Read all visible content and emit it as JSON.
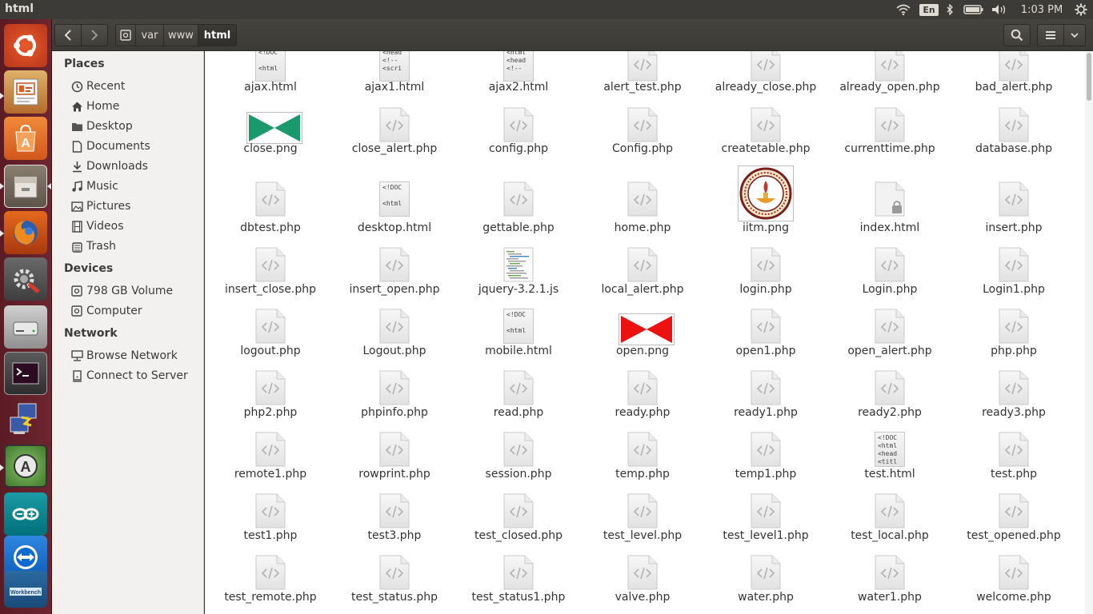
{
  "window": {
    "title": "html"
  },
  "top_panel": {
    "language": "En",
    "clock": "1:03 PM",
    "indicators": [
      "wifi-icon",
      "bluetooth-icon",
      "battery-icon",
      "volume-icon",
      "settings-gear-icon"
    ]
  },
  "launcher": {
    "items": [
      "ubuntu-logo-icon",
      "impress-presentation-icon",
      "software-center-icon",
      "files-manager-icon",
      "firefox-icon",
      "system-settings-icon",
      "disk-drive-icon",
      "terminal-icon",
      "remote-desktop-icon",
      "software-updater-icon",
      "arduino-icon",
      "teamviewer-icon",
      "mysql-workbench-icon"
    ]
  },
  "pathbar": {
    "crumbs": [
      "var",
      "www",
      "html"
    ]
  },
  "sidebar": {
    "places_heading": "Places",
    "places": [
      "Recent",
      "Home",
      "Desktop",
      "Documents",
      "Downloads",
      "Music",
      "Pictures",
      "Videos",
      "Trash"
    ],
    "devices_heading": "Devices",
    "devices": [
      "798 GB Volume",
      "Computer"
    ],
    "network_heading": "Network",
    "network": [
      "Browse Network",
      "Connect to Server"
    ]
  },
  "files": [
    [
      "ajax.html",
      "ajax1.html",
      "ajax2.html",
      "alert_test.php",
      "already_close.php",
      "already_open.php",
      "bad_alert.php"
    ],
    [
      "close.png",
      "close_alert.php",
      "config.php",
      "Config.php",
      "createtable.php",
      "currenttime.php",
      "database.php"
    ],
    [
      "dbtest.php",
      "desktop.html",
      "gettable.php",
      "home.php",
      "iitm.png",
      "index.html",
      "insert.php"
    ],
    [
      "insert_close.php",
      "insert_open.php",
      "jquery-3.2.1.js",
      "local_alert.php",
      "login.php",
      "Login.php",
      "Login1.php"
    ],
    [
      "logout.php",
      "Logout.php",
      "mobile.html",
      "open.png",
      "open1.php",
      "open_alert.php",
      "php.php"
    ],
    [
      "php2.php",
      "phpinfo.php",
      "read.php",
      "ready.php",
      "ready1.php",
      "ready2.php",
      "ready3.php"
    ],
    [
      "remote1.php",
      "rowprint.php",
      "session.php",
      "temp.php",
      "temp1.php",
      "test.html",
      "test.php"
    ],
    [
      "test1.php",
      "test3.php",
      "test_closed.php",
      "test_level.php",
      "test_level1.php",
      "test_local.php",
      "test_opened.php"
    ],
    [
      "test_remote.php",
      "test_status.php",
      "test_status1.php",
      "valve.php",
      "water.php",
      "water1.php",
      "welcome.php"
    ]
  ],
  "code_previews": {
    "ajax.html": "<!DOC\n\n<html",
    "ajax1.html": "<head\n<!--\n<scri",
    "ajax2.html": "<html\n<head\n<!--",
    "desktop.html": "<!DOC\n\n<html",
    "mobile.html": "<!DOC\n\n<html",
    "test.html": "<!DOC\n<html\n<head\n<titl"
  },
  "colors": {
    "close_png": "#1a9a6c",
    "open_png": "#ee1111",
    "launcher_bg": "#6e2630"
  }
}
